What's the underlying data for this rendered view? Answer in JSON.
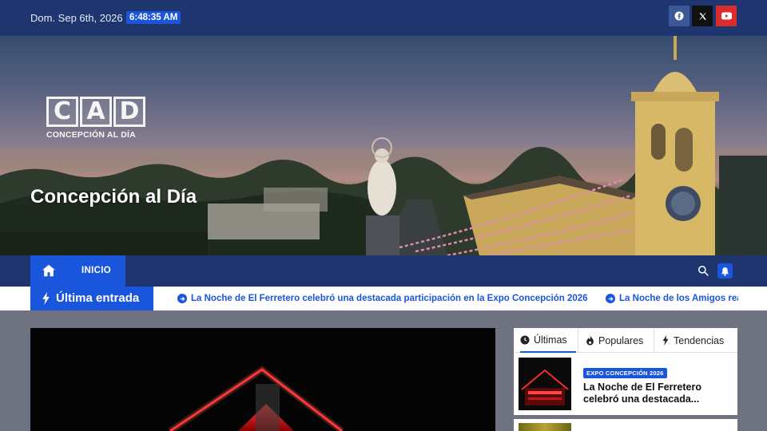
{
  "topbar": {
    "date": "Dom. Sep 6th, 2026",
    "time": "6:48:35 AM",
    "social": [
      {
        "name": "facebook",
        "color": "#3b5998"
      },
      {
        "name": "x",
        "color": "#111111"
      },
      {
        "name": "youtube",
        "color": "#d92c2c"
      }
    ]
  },
  "header": {
    "logo_letters": [
      "C",
      "A",
      "D"
    ],
    "logo_tagline": "CONCEPCIÓN AL DÍA",
    "site_title": "Concepción al Día"
  },
  "nav": {
    "items": [
      {
        "label": "INICIO",
        "active": true
      }
    ],
    "icons": [
      "home-icon",
      "search-icon",
      "bell-icon"
    ]
  },
  "ticker": {
    "label": "Última entrada",
    "items": [
      "La Noche de El Ferretero celebró una destacada participación en la Expo Concepción 2026",
      "La Noche de los Amigos reafirmó una"
    ]
  },
  "sidebar": {
    "tabs": [
      {
        "label": "Últimas",
        "icon": "clock-icon",
        "active": true
      },
      {
        "label": "Populares",
        "icon": "fire-icon",
        "active": false
      },
      {
        "label": "Tendencias",
        "icon": "bolt-icon",
        "active": false
      }
    ],
    "posts": [
      {
        "category": "EXPO CONCEPCIÓN 2026",
        "title": "La Noche de El Ferretero celebró una destacada..."
      }
    ]
  },
  "colors": {
    "primary_blue": "#1a56db",
    "dark_navy": "#1f3570",
    "page_bg": "#6f7280"
  }
}
